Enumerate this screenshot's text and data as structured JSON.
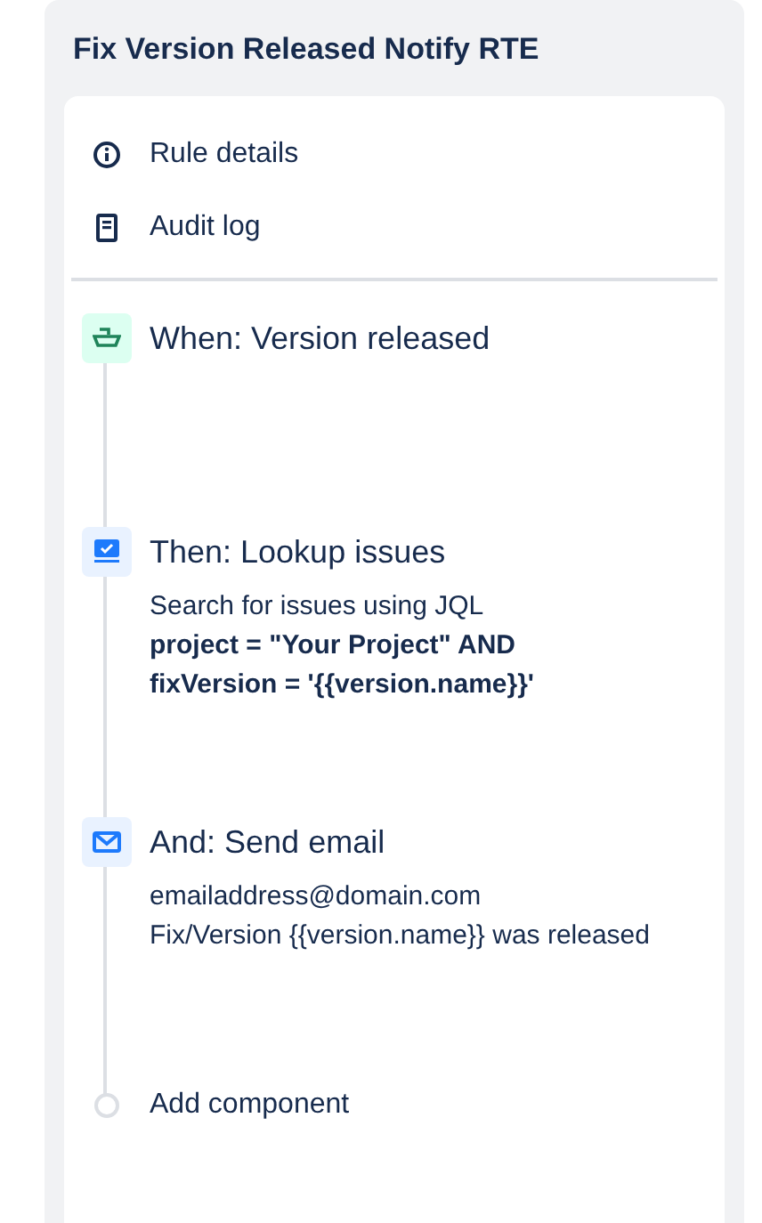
{
  "panel": {
    "title": "Fix Version Released Notify RTE"
  },
  "menu": [
    {
      "label": "Rule details",
      "kind": "info"
    },
    {
      "label": "Audit log",
      "kind": "log"
    }
  ],
  "steps": [
    {
      "kind": "trigger",
      "title": "When: Version released"
    },
    {
      "kind": "lookup",
      "title": "Then: Lookup issues",
      "details": [
        {
          "text": "Search for issues using JQL",
          "kind": "plain"
        },
        {
          "text": "project = \"Your Project\" AND fixVersion = '{{version.name}}'",
          "kind": "code"
        }
      ]
    },
    {
      "kind": "email",
      "title": "And: Send email",
      "details": [
        {
          "text": "emailaddress@domain.com",
          "kind": "plain"
        },
        {
          "text": "Fix/Version {{version.name}} was released",
          "kind": "plain"
        }
      ]
    }
  ],
  "add_component": {
    "label": "Add component"
  }
}
